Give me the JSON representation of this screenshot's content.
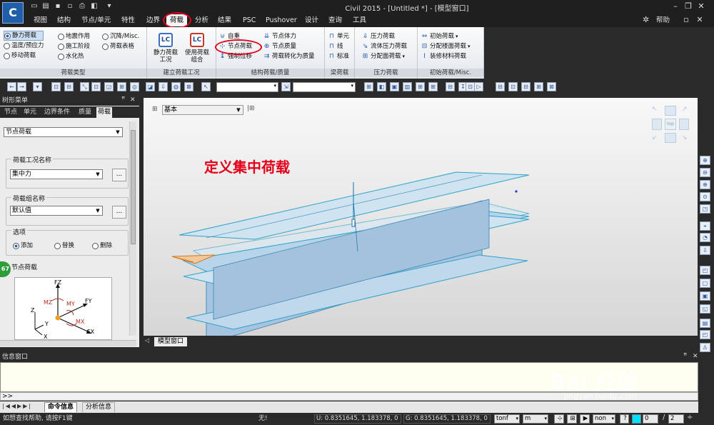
{
  "app": {
    "title": "Civil 2015 - [Untitled *] - [模型窗口]",
    "logo_text": "C"
  },
  "menu": {
    "items": [
      "视图",
      "结构",
      "节点/单元",
      "特性",
      "边界",
      "荷载",
      "分析",
      "结果",
      "PSC",
      "Pushover",
      "设计",
      "查询",
      "工具"
    ],
    "active": "荷载",
    "help": "帮助"
  },
  "ribbon": {
    "load_types": {
      "caption": "荷载类型",
      "col1": [
        "静力荷载",
        "温度/预应力",
        "移动荷载"
      ],
      "col2": [
        "地震作用",
        "施工阶段",
        "水化热"
      ],
      "col3": [
        "沉降/Misc.",
        "荷载表格"
      ]
    },
    "create_case": {
      "caption": "建立荷载工况",
      "btn1": "静力荷载\n工况",
      "btn2": "使用荷载\n组合",
      "ico1": "LC",
      "ico2": "LC"
    },
    "struct_load": {
      "caption": "结构荷载/质量",
      "col1": [
        "自重",
        "节点荷载",
        "强制位移"
      ],
      "col2": [
        "节点体力",
        "节点质量",
        "荷载转化为质量"
      ]
    },
    "beam_load": {
      "caption": "梁荷载",
      "items": [
        "单元",
        "线",
        "标准"
      ]
    },
    "pressure": {
      "caption": "压力荷载",
      "items": [
        "压力荷载",
        "流体压力荷载",
        "分配面荷载"
      ]
    },
    "initial": {
      "caption": "初始荷载/Misc.",
      "items": [
        "初始荷载",
        "分配楼面荷载",
        "装修材料荷载"
      ]
    }
  },
  "left_panel": {
    "header": "树形菜单",
    "tabs": [
      "节点",
      "单元",
      "边界条件",
      "质量",
      "荷载"
    ],
    "active_tab": "荷载",
    "load_type_select": "节点荷载",
    "case_label": "荷载工况名称",
    "case_value": "集中力",
    "group_label": "荷载组名称",
    "group_value": "默认值",
    "options_label": "选项",
    "options": [
      "添加",
      "替换",
      "删除"
    ],
    "options_selected": "添加",
    "node_load_label": "节点荷载",
    "badge": "67",
    "diagram_labels": {
      "fz": "FZ",
      "mz": "MZ",
      "my": "MY",
      "fy": "FY",
      "mx": "MX",
      "fx": "FX",
      "z": "Z",
      "y": "Y",
      "x": "X"
    }
  },
  "viewport": {
    "view_select": "基本",
    "annotation": "定义集中荷载",
    "annotation_color": "#e3001b",
    "tab": "模型窗口",
    "cube_label": "top"
  },
  "info": {
    "header": "信息窗口",
    "prompt": ">>",
    "tabs": [
      "命令信息",
      "分析信息"
    ],
    "active_tab": "命令信息"
  },
  "status": {
    "hint": "如想查找帮助, 请按F1键",
    "none": "无!",
    "u": "U: 0.8351645, 1.183378, 0",
    "g": "G: 0.8351645, 1.183378, 0",
    "force_unit": "tonf",
    "length_unit": "m",
    "none_short": "non",
    "help_q": "?",
    "num0": "0",
    "page": "2"
  },
  "watermark": {
    "text": "Bai 经验",
    "url": "jingyan.baidu.com"
  }
}
